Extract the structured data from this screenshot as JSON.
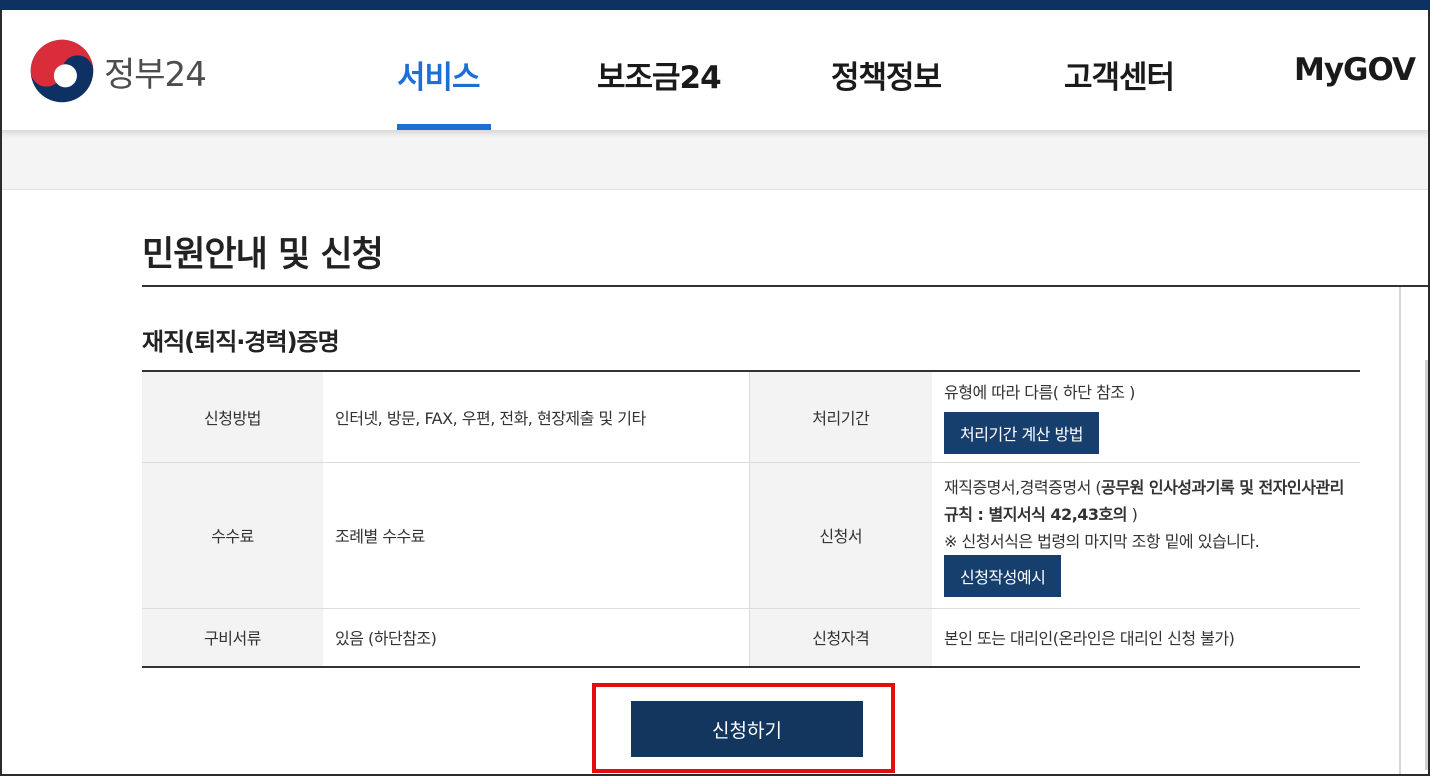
{
  "header": {
    "logo_text": "정부24",
    "nav": [
      {
        "label": "서비스"
      },
      {
        "label": "보조금24"
      },
      {
        "label": "정책정보"
      },
      {
        "label": "고객센터"
      },
      {
        "label": "MyGOV"
      }
    ]
  },
  "main": {
    "page_title": "민원안내 및 신청",
    "section_title": "재직(퇴직·경력)증명",
    "rows": [
      {
        "label1": "신청방법",
        "value1": "인터넷, 방문, FAX, 우편, 전화, 현장제출 및 기타",
        "label2": "처리기간",
        "value2": "유형에 따라 다름( 하단 참조 )",
        "button2": "처리기간 계산 방법"
      },
      {
        "label1": "수수료",
        "value1": "조례별 수수료",
        "label2": "신청서",
        "value2_pre": "재직증명서,경력증명서 (",
        "value2_bold": "공무원 인사성과기록 및 전자인사관리 규칙 : 별지서식 42,43호의",
        "value2_post": " )",
        "value2_note": "※ 신청서식은 법령의 마지막 조항 밑에 있습니다.",
        "button2": "신청작성예시"
      },
      {
        "label1": "구비서류",
        "value1": "있음 (하단참조)",
        "label2": "신청자격",
        "value2": "본인 또는 대리인(온라인은 대리인 신청 불가)"
      }
    ],
    "apply_button": "신청하기"
  },
  "colors": {
    "brand_navy": "#0e3164",
    "nav_active": "#1d6fd6",
    "button_navy": "#12365e",
    "highlight_red": "#e30d0d"
  }
}
